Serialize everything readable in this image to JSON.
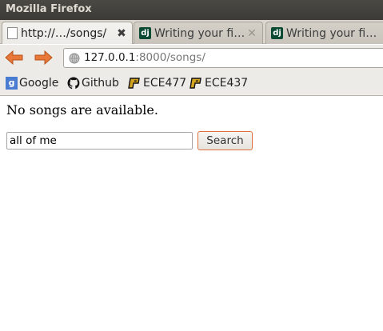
{
  "window": {
    "title": "Mozilla Firefox"
  },
  "tabs": [
    {
      "label": "http://…/songs/",
      "favicon": "blank-page-icon",
      "active": true
    },
    {
      "label": "Writing your fi…",
      "favicon": "django-icon",
      "active": false
    },
    {
      "label": "Writing your fi…",
      "favicon": "django-icon",
      "active": false
    }
  ],
  "django_favicon_text": "dj",
  "navigation": {
    "back": "back-arrow-icon",
    "forward": "forward-arrow-icon",
    "url_host": "127.0.0.1",
    "url_rest": ":8000/songs/"
  },
  "bookmarks": [
    {
      "label": "Google",
      "icon": "google-icon",
      "icon_text": "g"
    },
    {
      "label": "Github",
      "icon": "github-icon"
    },
    {
      "label": "ECE477",
      "icon": "purdue-p-icon"
    },
    {
      "label": "ECE437",
      "icon": "purdue-p-icon"
    }
  ],
  "page": {
    "message": "No songs are available.",
    "search": {
      "value": "all of me",
      "button_label": "Search"
    }
  },
  "colors": {
    "titlebar": "#3c3b37",
    "nav_arrow": "#e8773a",
    "django_green": "#0c4b33",
    "search_button_border": "#e0703a"
  }
}
